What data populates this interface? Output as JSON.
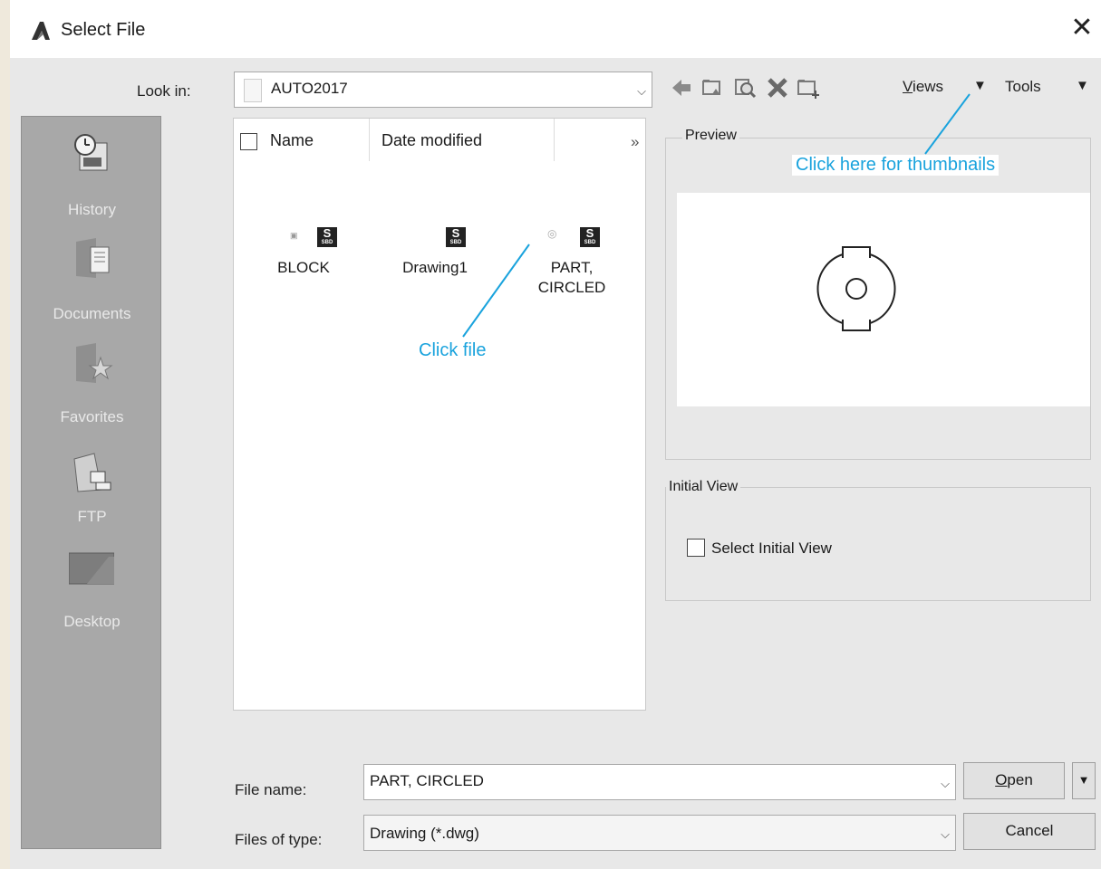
{
  "window": {
    "title": "Select File",
    "close_icon": "close-icon"
  },
  "lookin": {
    "label": "Look in:",
    "value": "AUTO2017"
  },
  "toolbar": {
    "views_label": "Views",
    "tools_label": "Tools",
    "views_mnemonic": "V",
    "tools_rest": "Tools"
  },
  "places": [
    {
      "label": "History",
      "icon": "history-icon"
    },
    {
      "label": "Documents",
      "icon": "documents-icon"
    },
    {
      "label": "Favorites",
      "icon": "favorites-icon"
    },
    {
      "label": "FTP",
      "icon": "ftp-icon"
    },
    {
      "label": "Desktop",
      "icon": "desktop-icon"
    }
  ],
  "filelist": {
    "columns": [
      "Name",
      "Date modified"
    ],
    "more_icon": "»",
    "files": [
      {
        "name": "BLOCK"
      },
      {
        "name": "Drawing1"
      },
      {
        "name_line1": "PART,",
        "name_line2": "CIRCLED"
      }
    ]
  },
  "preview": {
    "legend": "Preview"
  },
  "initial_view": {
    "legend": "Initial View",
    "checkbox_label": "Select Initial View"
  },
  "filename": {
    "label": "File name:",
    "value": "PART, CIRCLED"
  },
  "filetype": {
    "label": "Files of type:",
    "value": "Drawing (*.dwg)"
  },
  "buttons": {
    "open": "Open",
    "cancel": "Cancel"
  },
  "annotations": {
    "thumbnails": "Click here for thumbnails",
    "click_file": "Click file"
  },
  "colors": {
    "annotation": "#1aa3dd",
    "places_bg": "#a8a8a8"
  }
}
